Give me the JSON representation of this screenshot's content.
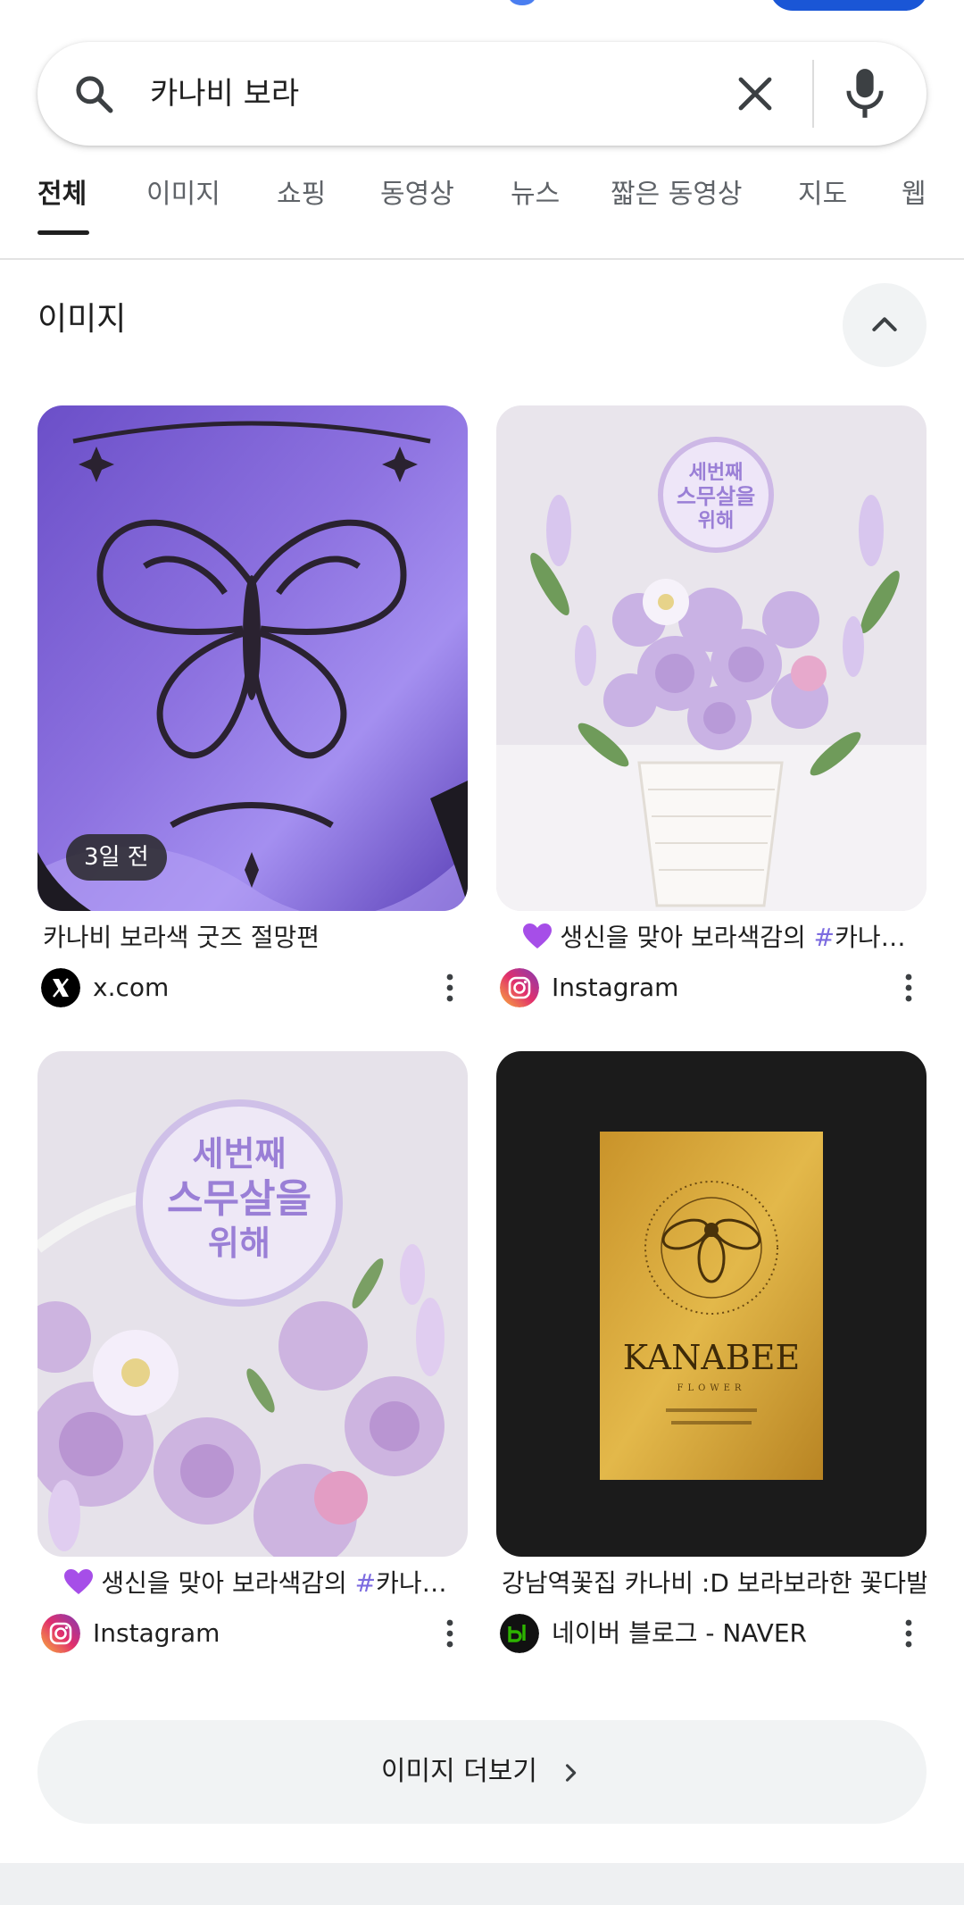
{
  "search": {
    "query": "카나비 보라",
    "icons": {
      "search": "search-icon",
      "clear": "close-icon",
      "voice": "mic-icon"
    }
  },
  "tabs": [
    {
      "label": "전체",
      "active": true
    },
    {
      "label": "이미지",
      "active": false
    },
    {
      "label": "쇼핑",
      "active": false
    },
    {
      "label": "동영상",
      "active": false
    },
    {
      "label": "뉴스",
      "active": false
    },
    {
      "label": "짧은 동영상",
      "active": false
    },
    {
      "label": "지도",
      "active": false
    },
    {
      "label": "웹",
      "active": false
    }
  ],
  "images_section": {
    "title": "이미지",
    "collapse_icon": "chevron-up-icon",
    "results": [
      {
        "title": "카나비 보라색 굿즈 절망편",
        "source": "x.com",
        "badge": "3일 전",
        "favicon": "x-logo-icon"
      },
      {
        "title_prefix": "생신을 맞아 보라색감의 ",
        "title_hash": "#",
        "title_suffix": "카나…",
        "source": "Instagram",
        "favicon": "instagram-icon",
        "heart": "purple-heart-icon"
      },
      {
        "title_prefix": "생신을 맞아 보라색감의 ",
        "title_hash": "#",
        "title_suffix": "카나…",
        "source": "Instagram",
        "favicon": "instagram-icon",
        "heart": "purple-heart-icon"
      },
      {
        "title": "강남역꽃집 카나비 :D 보라보라한 꽃다발 …",
        "source": "네이버 블로그 - NAVER",
        "favicon": "naver-blog-icon",
        "logo_text": "KANABEE",
        "logo_sub": "FLOWER"
      }
    ],
    "more_label": "이미지 더보기",
    "more_icon": "chevron-right-icon"
  },
  "colors": {
    "accent_blue": "#1a56d6",
    "purple_satin": "#8a6fd8",
    "lavender": "#cdb8e6",
    "gold_card": "#d9a93a",
    "dark_bg": "#1b1b1b",
    "heart": "#a64ee8",
    "hash": "#7c6be0"
  }
}
